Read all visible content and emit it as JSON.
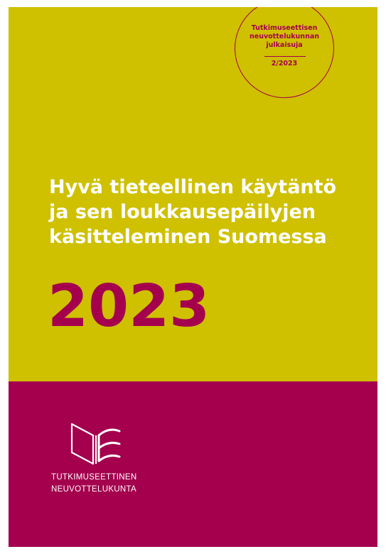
{
  "series": {
    "name_lines": [
      "Tutkimuseettisen",
      "neuvottelukunnan",
      "julkaisuja"
    ],
    "number": "2/2023"
  },
  "title": {
    "lines": [
      "Hyvä tieteellinen käytäntö",
      "ja sen loukkausepäilyjen",
      "käsitteleminen Suomessa"
    ]
  },
  "year": "2023",
  "publisher": {
    "logo_icon": "open-book-icon",
    "name_lines": [
      "TUTKIMUSEETTINEN",
      "NEUVOTTELUKUNTA"
    ]
  },
  "colors": {
    "top_background": "#cfc000",
    "bottom_background": "#a4004e",
    "accent": "#a4004e",
    "title_text": "#ffffff"
  }
}
